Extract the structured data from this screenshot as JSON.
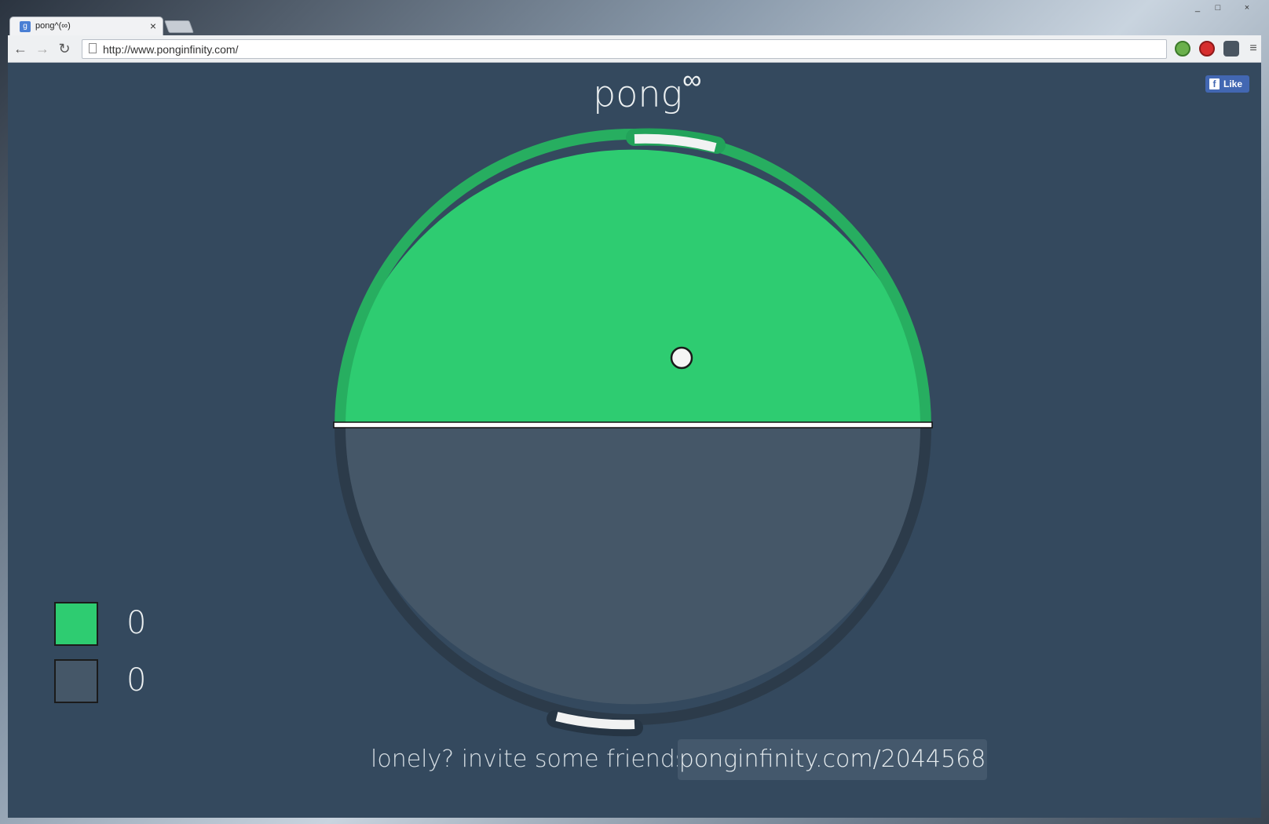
{
  "browser": {
    "tab_title": "pong^(∞)",
    "tab_favicon_letter": "g",
    "tab_close": "×",
    "url": "http://www.ponginfinity.com/",
    "window_controls": [
      "_",
      "□",
      "×"
    ]
  },
  "page": {
    "title": "pong",
    "title_superscript": "∞",
    "fb_like_label": "Like",
    "fb_icon_letter": "f"
  },
  "game": {
    "colors": {
      "background": "#34495e",
      "green_half": "#2ecc71",
      "green_rim": "#27ae60",
      "gray_half": "#455768",
      "gray_rim": "#2c3b4a",
      "paddle": "#f1f2f2",
      "ball": "#f5f5f5"
    }
  },
  "scores": [
    {
      "team": "green",
      "color": "#2ecc71",
      "value": "0"
    },
    {
      "team": "gray",
      "color": "#455768",
      "value": "0"
    }
  ],
  "invite": {
    "text": "lonely?  invite some friends",
    "link": "ponginfinity.com/2044568"
  }
}
